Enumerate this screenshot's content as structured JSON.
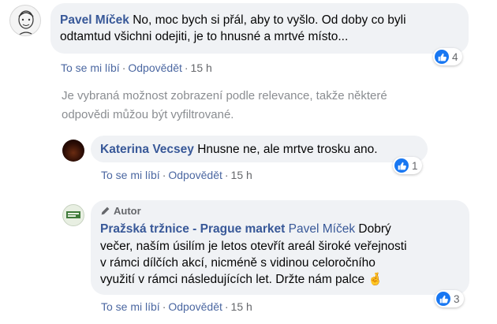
{
  "comment1": {
    "author": "Pavel Míček",
    "text_line1": "No, moc bych si přál, aby to vyšlo. Od doby co byli",
    "text_line2": "odtamtud všichni odejiti, je to hnusné a mrtvé místo...",
    "like_label": "To se mi líbí",
    "reply_label": "Odpovědět",
    "time": "15 h",
    "reaction_count": "4"
  },
  "relevance_notice": {
    "line1": "Je vybraná možnost zobrazení podle relevance, takže některé",
    "line2": "odpovědi můžou být vyfiltrované."
  },
  "reply1": {
    "author": "Katerina Vecsey",
    "text": "Hnusne ne, ale mrtve trosku ano.",
    "like_label": "To se mi líbí",
    "reply_label": "Odpovědět",
    "time": "15 h",
    "reaction_count": "1"
  },
  "reply2": {
    "author_tag": "Autor",
    "author": "Pražská tržnice - Prague market",
    "mention": "Pavel Míček",
    "text_line1_rest": "Dobrý",
    "text_line2": "večer, naším úsilím je letos otevřít areál široké veřejnosti",
    "text_line3": "v rámci dílčích akcí, nicméně s vidinou celoročního",
    "text_line4": "využití v rámci následujících let. Držte nám palce",
    "emoji": "🤞",
    "like_label": "To se mi líbí",
    "reply_label": "Odpovědět",
    "time": "15 h",
    "reaction_count": "3"
  },
  "colors": {
    "name": "#385898",
    "like_blue": "#1877f2",
    "bubble": "#f0f2f5",
    "muted": "#65676b"
  }
}
